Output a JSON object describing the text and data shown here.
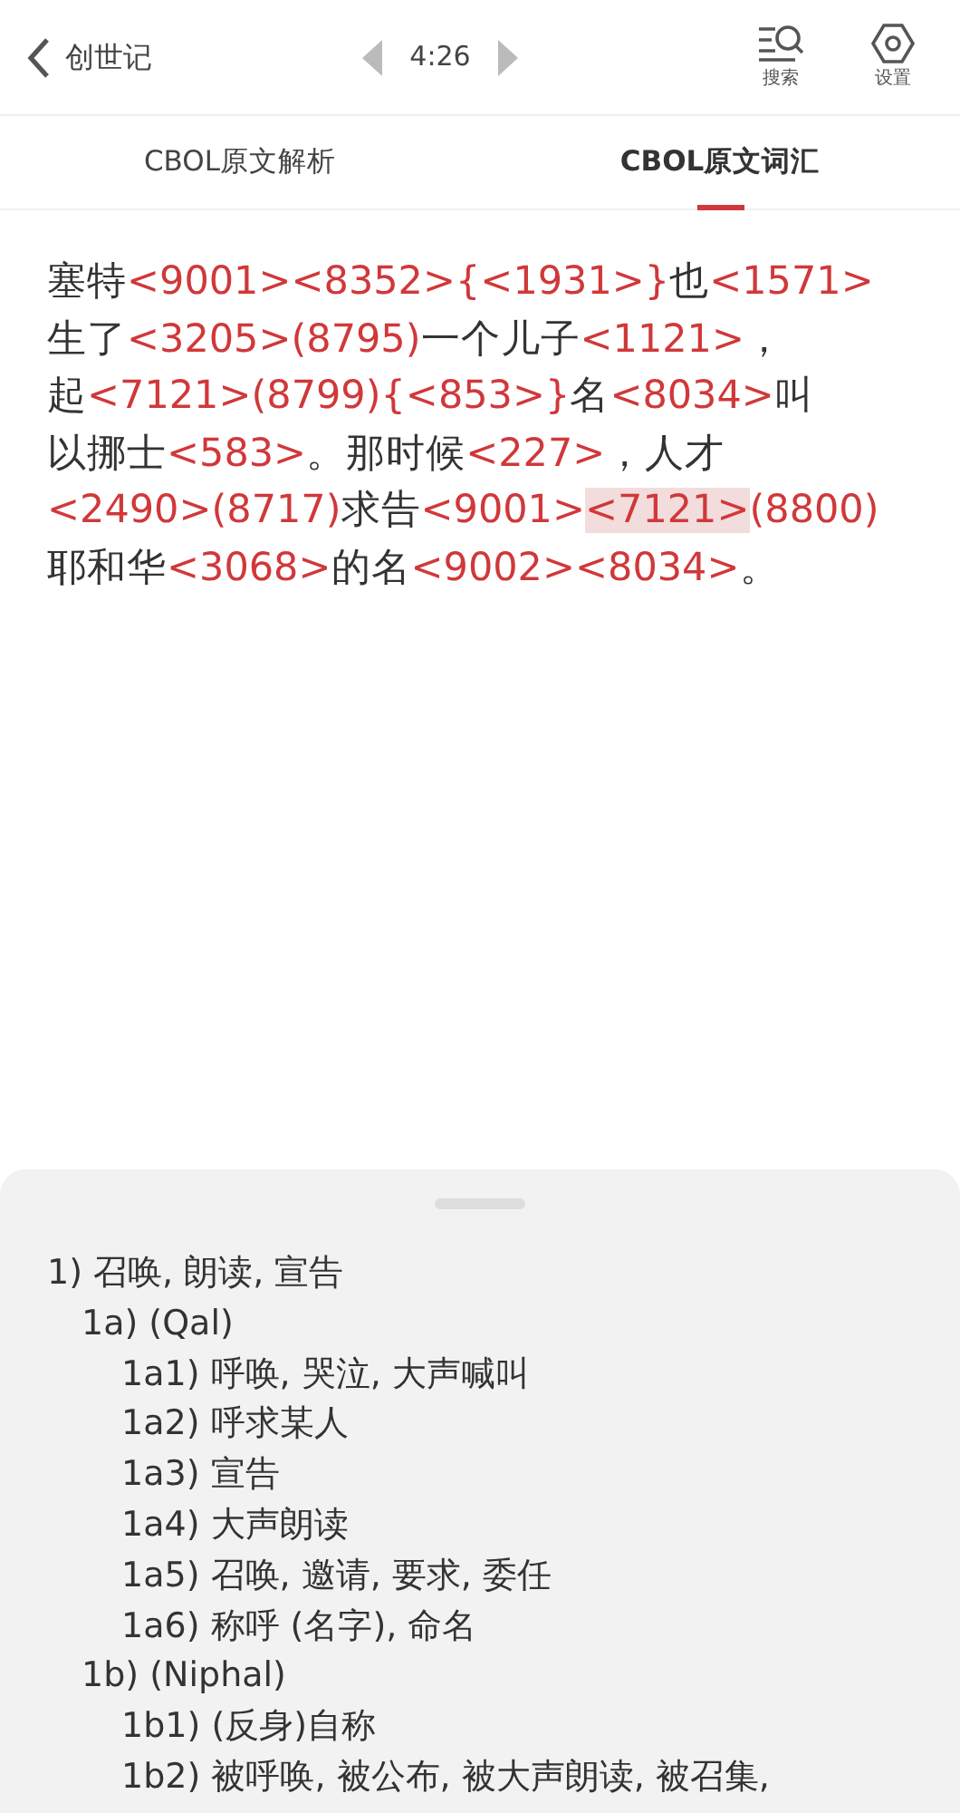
{
  "header": {
    "title": "创世记",
    "chapter": "4:26",
    "actions": [
      {
        "kind": "search",
        "label": "搜索"
      },
      {
        "kind": "settings",
        "label": "设置"
      }
    ]
  },
  "tabs": [
    {
      "label": "CBOL原文解析",
      "selected": false
    },
    {
      "label": "CBOL原文词汇",
      "selected": true
    }
  ],
  "verse_lines": [
    [
      {
        "text": "塞特",
        "kind": "word",
        "selected": false
      },
      {
        "text": "<9001>",
        "kind": "code",
        "selected": false
      },
      {
        "text": "<8352>",
        "kind": "code",
        "selected": false
      },
      {
        "text": "{<1931>}",
        "kind": "code",
        "selected": false
      },
      {
        "text": "也",
        "kind": "word",
        "selected": false
      },
      {
        "text": "<1571>",
        "kind": "code",
        "selected": false
      }
    ],
    [
      {
        "text": "生了",
        "kind": "word",
        "selected": false
      },
      {
        "text": "<3205>",
        "kind": "code",
        "selected": false
      },
      {
        "text": "(8795)",
        "kind": "code",
        "selected": false
      },
      {
        "text": "一个儿子",
        "kind": "word",
        "selected": false
      },
      {
        "text": "<1121>",
        "kind": "code",
        "selected": false
      },
      {
        "text": "，",
        "kind": "word",
        "selected": false
      }
    ],
    [
      {
        "text": "起",
        "kind": "word",
        "selected": false
      },
      {
        "text": "<7121>",
        "kind": "code",
        "selected": false
      },
      {
        "text": "(8799)",
        "kind": "code",
        "selected": false
      },
      {
        "text": "{<853>}",
        "kind": "code",
        "selected": false
      },
      {
        "text": "名",
        "kind": "word",
        "selected": false
      },
      {
        "text": "<8034>",
        "kind": "code",
        "selected": false
      },
      {
        "text": "叫",
        "kind": "word",
        "selected": false
      }
    ],
    [
      {
        "text": "以挪士",
        "kind": "word",
        "selected": false
      },
      {
        "text": "<583>",
        "kind": "code",
        "selected": false
      },
      {
        "text": "。那时候",
        "kind": "word",
        "selected": false
      },
      {
        "text": "<227>",
        "kind": "code",
        "selected": false
      },
      {
        "text": "，人才",
        "kind": "word",
        "selected": false
      }
    ],
    [
      {
        "text": "<2490>",
        "kind": "code",
        "selected": false
      },
      {
        "text": "(8717)",
        "kind": "code",
        "selected": false
      },
      {
        "text": "求告",
        "kind": "word",
        "selected": false
      },
      {
        "text": "<9001>",
        "kind": "code",
        "selected": false
      },
      {
        "text": "<7121>",
        "kind": "code",
        "selected": true
      },
      {
        "text": "(8800)",
        "kind": "code",
        "selected": false
      }
    ],
    [
      {
        "text": "耶和华",
        "kind": "word",
        "selected": false
      },
      {
        "text": "<3068>",
        "kind": "code",
        "selected": false
      },
      {
        "text": "的名",
        "kind": "word",
        "selected": false
      },
      {
        "text": "<9002>",
        "kind": "code",
        "selected": false
      },
      {
        "text": "<8034>",
        "kind": "code",
        "selected": false
      },
      {
        "text": "。",
        "kind": "word",
        "selected": false
      }
    ]
  ],
  "definitions": [
    {
      "text": "1) 召唤, 朗读, 宣告",
      "children": [
        {
          "text": "1a) (Qal)",
          "children": [
            {
              "text": "1a1) 呼唤, 哭泣, 大声喊叫"
            },
            {
              "text": "1a2) 呼求某人"
            },
            {
              "text": "1a3) 宣告"
            },
            {
              "text": "1a4) 大声朗读"
            },
            {
              "text": "1a5) 召唤, 邀请, 要求, 委任"
            },
            {
              "text": "1a6) 称呼 (名字), 命名"
            }
          ]
        },
        {
          "text": "1b) (Niphal)",
          "children": [
            {
              "text": "1b1) (反身)自称"
            },
            {
              "text": "1b2) 被呼唤, 被公布, 被大声朗读, 被召集,"
            }
          ]
        }
      ]
    }
  ]
}
